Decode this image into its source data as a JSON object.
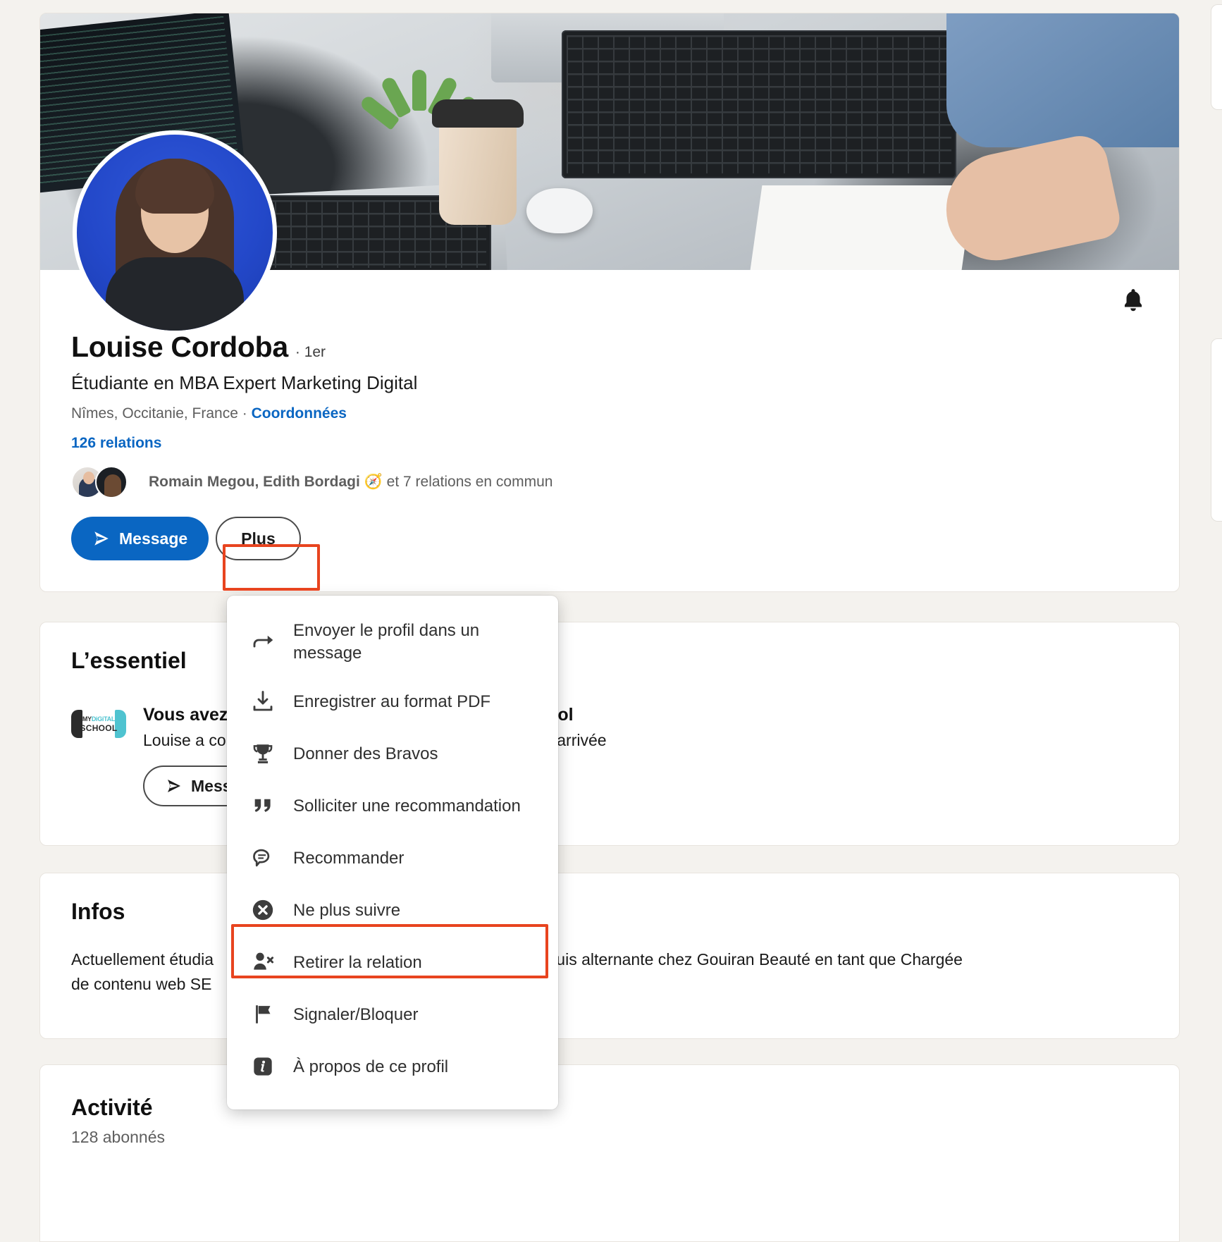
{
  "profile": {
    "name": "Louise Cordoba",
    "degree": "· 1er",
    "headline": "Étudiante en MBA Expert Marketing Digital",
    "location": "Nîmes, Occitanie, France",
    "location_separator": "·",
    "contact_info_label": "Coordonnées",
    "connections_label": "126 relations",
    "mutual_names": "Romain Megou, Edith Bordagi",
    "mutual_badge": "🧭",
    "mutual_rest": "et 7 relations en commun",
    "notify_icon": "bell-icon"
  },
  "actions": {
    "message_label": "Message",
    "message_icon": "send-icon",
    "more_label": "Plus"
  },
  "dropdown": {
    "items": [
      {
        "label": "Envoyer le profil dans un message",
        "icon": "share-arrow-icon",
        "two_line": true
      },
      {
        "label": "Enregistrer au format PDF",
        "icon": "download-icon",
        "two_line": false
      },
      {
        "label": "Donner des Bravos",
        "icon": "trophy-icon",
        "two_line": false
      },
      {
        "label": "Solliciter une recommandation",
        "icon": "quote-icon",
        "two_line": false
      },
      {
        "label": "Recommander",
        "icon": "speech-bubble-icon",
        "two_line": false
      },
      {
        "label": "Ne plus suivre",
        "icon": "circle-x-icon",
        "two_line": false
      },
      {
        "label": "Retirer la relation",
        "icon": "person-remove-icon",
        "two_line": false
      },
      {
        "label": "Signaler/Bloquer",
        "icon": "flag-icon",
        "two_line": false
      },
      {
        "label": "À propos de ce profil",
        "icon": "info-icon",
        "two_line": false
      }
    ]
  },
  "essential": {
    "title": "L’essentiel",
    "school_logo_top_my": "MY",
    "school_logo_top_digital": "DiGiTAL",
    "school_logo_bottom": "SCHOOL",
    "line1_visible_start": "Vous avez",
    "line1_visible_end": "alSchool",
    "line2_visible_start": "Louise a co",
    "line2_visible_end": "re arrivée",
    "button_label": "Mess"
  },
  "infos": {
    "title": "Infos",
    "line1_start": "Actuellement étudia",
    "line1_end": "suis alternante chez Gouiran Beauté en tant que Chargée",
    "line2_start": "de contenu web SE"
  },
  "activity": {
    "title": "Activité",
    "followers": "128 abonnés"
  },
  "colors": {
    "brand_blue": "#0a66c2",
    "highlight_red": "#e8441f",
    "page_bg": "#f4f2ee",
    "card_bg": "#ffffff",
    "text_primary": "#101010",
    "text_secondary": "#5e5e5e"
  }
}
